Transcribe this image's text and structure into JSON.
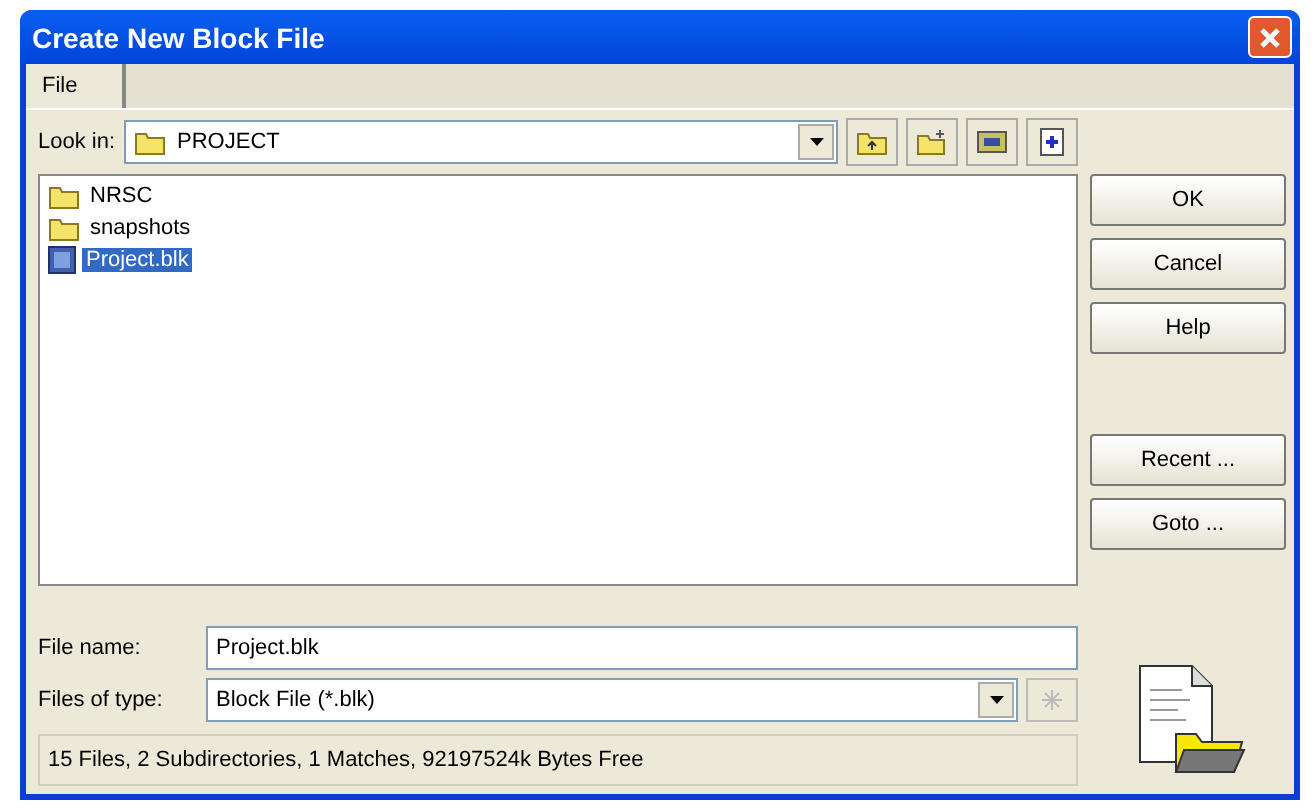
{
  "window": {
    "title": "Create New Block File"
  },
  "tabs": [
    {
      "label": "File",
      "selected": true
    }
  ],
  "look_in": {
    "label": "Look in:",
    "value": "PROJECT"
  },
  "files": [
    {
      "name": "NRSC",
      "kind": "folder",
      "selected": false
    },
    {
      "name": "snapshots",
      "kind": "folder",
      "selected": false
    },
    {
      "name": "Project.blk",
      "kind": "file",
      "selected": true
    }
  ],
  "buttons": [
    "OK",
    "Cancel",
    "Help"
  ],
  "extra_buttons": [
    "Recent ...",
    "Goto ..."
  ],
  "file_name": {
    "label": "File name:",
    "value": "Project.blk"
  },
  "file_type": {
    "label": "Files of type:",
    "value": "Block File (*.blk)"
  },
  "status_bar": "15 Files, 2 Subdirectories, 1 Matches, 92197524k Bytes Free"
}
